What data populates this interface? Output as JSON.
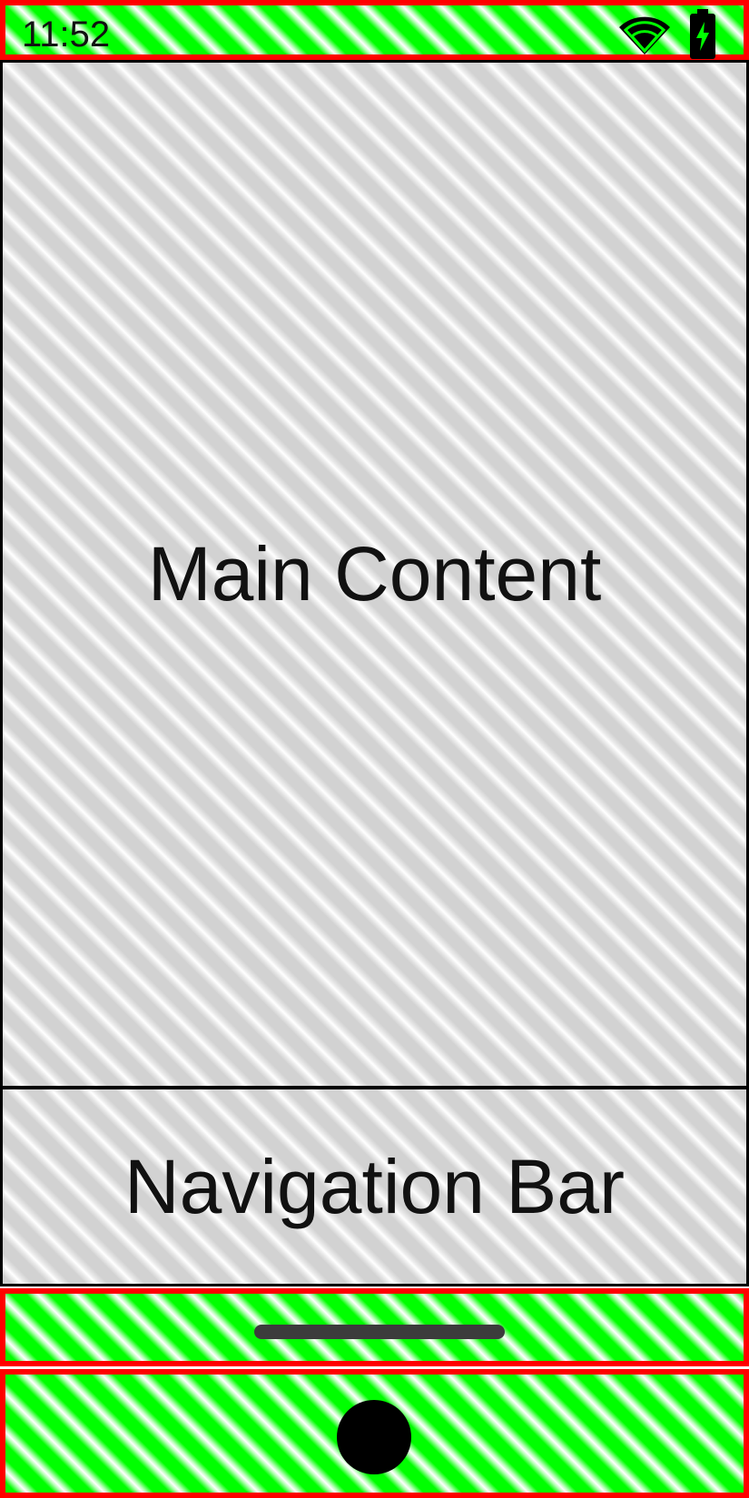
{
  "status_bar": {
    "time": "11:52",
    "icons": [
      "wifi-icon",
      "battery-charging-icon"
    ]
  },
  "main": {
    "label": "Main Content"
  },
  "navigation_bar": {
    "label": "Navigation Bar"
  },
  "gesture_bar": {
    "icon": "gesture-handle"
  },
  "bottom_area": {
    "icon": "home-dot"
  },
  "colors": {
    "system_border": "#ff0000",
    "system_fill": "#00ff00",
    "content_border": "#000000",
    "content_fill": "#d2d2d2"
  }
}
